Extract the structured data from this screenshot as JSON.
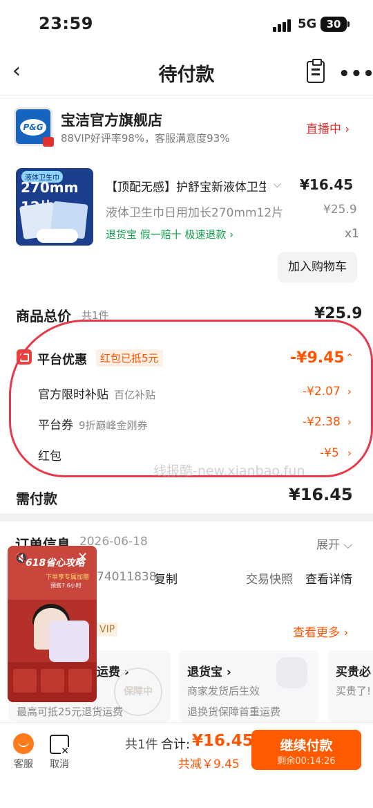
{
  "status": {
    "time": "23:59",
    "network": "5G",
    "battery": "30"
  },
  "nav": {
    "title": "待付款"
  },
  "shop": {
    "name": "宝洁官方旗舰店",
    "sub": "88VIP好评率98%，客服满意度93%",
    "live": "直播中 ›",
    "logo_text": "P&G"
  },
  "product": {
    "img_tag": "液体卫生巾",
    "img_big": "270mm 12片",
    "title": "【顶配无感】护舒宝新液体卫生巾日用加长",
    "price": "¥16.45",
    "spec": "液体卫生巾日用加长270mm12片",
    "orig_price": "¥25.9",
    "services": "退货宝  假一赔十  极速退款 ›",
    "qty": "x1",
    "add_cart": "加入购物车"
  },
  "summary": {
    "total_label": "商品总价",
    "total_count": "共1件",
    "total_value": "¥25.9",
    "platform_label": "平台优惠",
    "hongbao_tag": "红包已抵5元",
    "platform_value": "-¥9.45",
    "rows": [
      {
        "label": "官方限时补贴",
        "sub": "百亿补贴",
        "value": "-¥2.07"
      },
      {
        "label": "平台券",
        "sub": "9折巅峰金刚券",
        "value": "-¥2.38"
      },
      {
        "label": "红包",
        "sub": "",
        "value": "-¥5"
      }
    ],
    "due_label": "需付款",
    "due_value": "¥16.45",
    "watermark": "线报酷-new.xianbao.fun"
  },
  "order": {
    "title": "订单信息",
    "date": "2026-06-18",
    "expand": "展开",
    "number": "74011838",
    "copy": "复制",
    "snapshot": "交易快照",
    "detail": "查看详情",
    "vip": "VIP",
    "see_more": "查看更多 ›",
    "boxes": [
      {
        "title": "运费 ›",
        "sub": ""
      },
      {
        "title": "退货宝 ›",
        "sub": "商家发货后生效",
        "sub2": "退换货保障首重运费"
      },
      {
        "title": "买贵必",
        "sub": "买贵了!"
      }
    ],
    "stamp": "保障中",
    "fee_text": "最高可抵25元退货运费"
  },
  "video": {
    "title": "618省心攻略",
    "subtitle": "下单享专属加赠",
    "date": "预售7.6小时"
  },
  "bottom": {
    "service": "客服",
    "cancel": "取消",
    "count": "共1件",
    "sum_label": "合计:",
    "sum_value": "¥16.45",
    "saved": "共减￥9.45",
    "pay": "继续付款",
    "countdown": "剩余00:14:26"
  },
  "colors": {
    "accent": "#ff5500",
    "brand_red": "#e0312f",
    "service_green": "#12a04c"
  }
}
